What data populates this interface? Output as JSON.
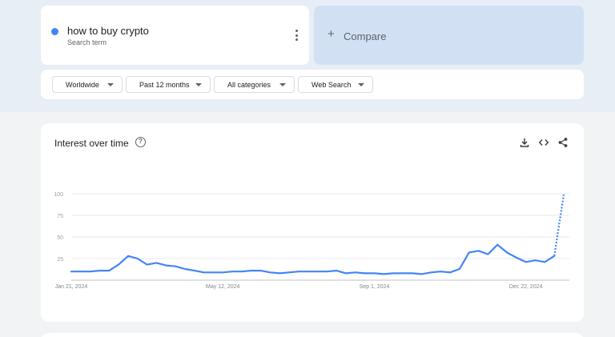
{
  "search_term": {
    "name": "how to buy crypto",
    "subtitle": "Search term",
    "color": "#4285f4"
  },
  "compare": {
    "plus": "+",
    "label": "Compare"
  },
  "filters": [
    {
      "label": "Worldwide"
    },
    {
      "label": "Past 12 months"
    },
    {
      "label": "All categories"
    },
    {
      "label": "Web Search"
    }
  ],
  "chart_card": {
    "title": "Interest over time",
    "help_symbol": "?",
    "icons": [
      "download-icon",
      "embed-code-icon",
      "share-icon"
    ]
  },
  "chart_data": {
    "type": "line",
    "title": "Interest over time",
    "xlabel": "",
    "ylabel": "",
    "ylim": [
      0,
      100
    ],
    "yticks": [
      25,
      50,
      75,
      100
    ],
    "xtick_labels": [
      "Jan 21, 2024",
      "May 12, 2024",
      "Sep 1, 2024",
      "Dec 22, 2024"
    ],
    "xtick_indices": [
      0,
      16,
      32,
      48
    ],
    "grid": true,
    "series": [
      {
        "color": "#4285f4",
        "values": [
          10,
          10,
          10,
          11,
          11,
          18,
          28,
          25,
          18,
          20,
          17,
          16,
          13,
          11,
          9,
          9,
          9,
          10,
          10,
          11,
          11,
          9,
          8,
          9,
          10,
          10,
          10,
          10,
          11,
          8,
          9,
          8,
          8,
          7,
          8,
          8,
          8,
          7,
          9,
          10,
          9,
          13,
          32,
          34,
          30,
          41,
          32,
          26,
          21,
          23,
          21,
          28,
          99
        ],
        "partial_from_index": 51
      }
    ]
  }
}
